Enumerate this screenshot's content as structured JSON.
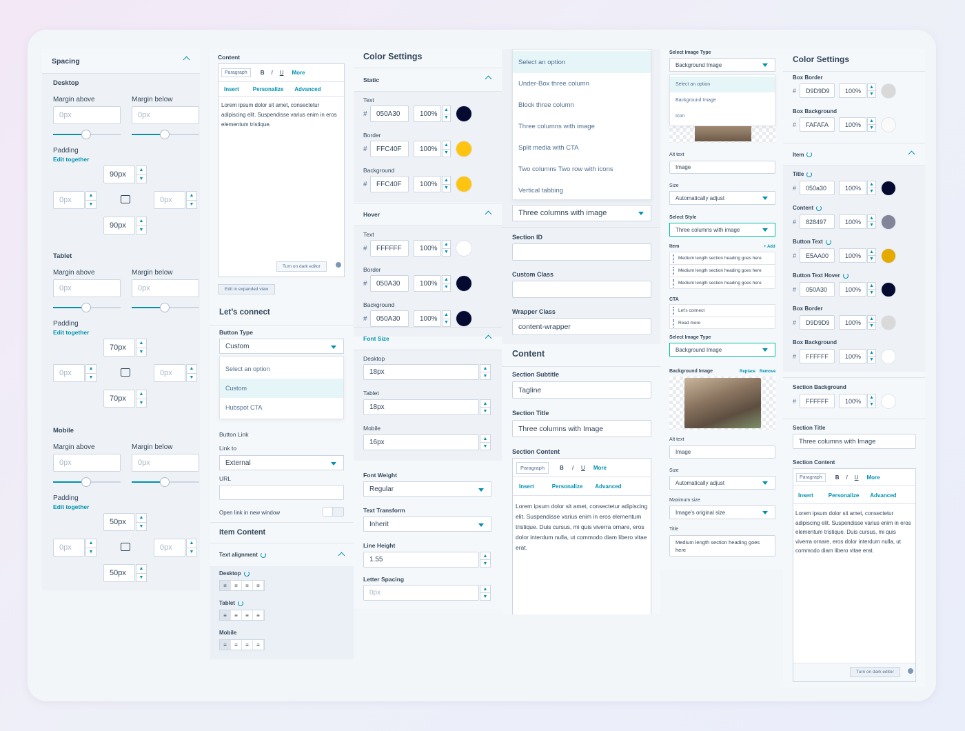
{
  "spacing": {
    "title": "Spacing",
    "desktop": "Desktop",
    "tablet": "Tablet",
    "mobile": "Mobile",
    "margin_above": "Margin above",
    "margin_below": "Margin below",
    "padding": "Padding",
    "edit_together": "Edit together",
    "zero": "0px",
    "desktop_pad": "90px",
    "tablet_pad": "70px",
    "mobile_pad": "50px"
  },
  "content_editor": {
    "label": "Content",
    "paragraph": "Paragraph",
    "more": "More",
    "insert": "Insert",
    "personalize": "Personalize",
    "advanced": "Advanced",
    "text": "Lorem ipsum dolor sit amet, consectetur adipiscing elit. Suspendisse varius enim in eros elementum tristique.",
    "dark_editor": "Turn on dark editor",
    "expanded": "Edit in expanded view"
  },
  "lets_connect": {
    "title": "Let’s connect",
    "button_type": "Button Type",
    "button_type_value": "Custom",
    "options": [
      "Select an option",
      "Custom",
      "Hubspot CTA"
    ],
    "button_link": "Button Link",
    "link_to": "Link to",
    "link_value": "External",
    "url": "URL",
    "open_new": "Open link in new window",
    "item_content": "Item Content",
    "text_alignment": "Text alignment",
    "desktop": "Desktop",
    "tablet": "Tablet",
    "mobile": "Mobile"
  },
  "color_settings": {
    "title": "Color Settings",
    "static": "Static",
    "hover": "Hover",
    "text": "Text",
    "border": "Border",
    "background": "Background",
    "static_text": "050A30",
    "static_border": "FFC40F",
    "static_bg": "FFC40F",
    "hover_text": "FFFFFF",
    "hover_border": "050A30",
    "hover_bg": "050A30",
    "pct": "100%",
    "font_size": "Font Size",
    "desktop": "Desktop",
    "tablet": "Tablet",
    "mobile": "Mobile",
    "fs_desktop": "18px",
    "fs_tablet": "18px",
    "fs_mobile": "16px",
    "font_weight": "Font Weight",
    "font_weight_value": "Regular",
    "text_transform": "Text Transform",
    "text_transform_value": "Inherit",
    "line_height": "Line Height",
    "line_height_value": "1.55",
    "letter_spacing": "Letter Spacing",
    "letter_spacing_value": "0px"
  },
  "layout": {
    "options": [
      "Select an option",
      "Under-Box three column",
      "Block three column",
      "Three columns with image",
      "Split media with CTA",
      "Two columns Two row with icons",
      "Vertical tabbing"
    ],
    "selected": "Three columns with image",
    "section_id": "Section ID",
    "custom_class": "Custom Class",
    "wrapper_class": "Wrapper Class",
    "wrapper_value": "content-wrapper",
    "content": "Content",
    "section_subtitle": "Section Subtitle",
    "subtitle_value": "Tagline",
    "section_title": "Section Title",
    "title_value": "Three columns with Image",
    "section_content": "Section Content",
    "text": "Lorem ipsum dolor sit amet, consectetur adipiscing elit. Suspendisse varius enim in eros elementum tristique. Duis cursus, mi quis viverra ornare, eros dolor interdum nulla, ut commodo diam libero vitae erat."
  },
  "image_col": {
    "select_image_type": "Select Image Type",
    "image_type_value": "Background Image",
    "type_options": [
      "Select an option",
      "Background Image",
      "Icon"
    ],
    "alt_text": "Alt text",
    "alt_value": "Image",
    "size": "Size",
    "size_value": "Automatically adjust",
    "select_style": "Select Style",
    "style_value": "Three columns with image",
    "item": "Item",
    "add": "+ Add",
    "items": [
      "Medium length section heading goes here",
      "Medium length section heading goes here",
      "Medium length section heading goes here"
    ],
    "cta": "CTA",
    "cta_items": [
      "Let’s connect",
      "Read more"
    ],
    "background_image": "Background Image",
    "replace": "Replace",
    "remove": "Remove",
    "max_size": "Maximum size",
    "max_value": "Image's original size",
    "title": "Title",
    "title_value": "Medium length section heading goes here"
  },
  "color2": {
    "title": "Color Settings",
    "box_border": "Box Border",
    "box_border_val": "D9D9D9",
    "box_bg": "Box Background",
    "box_bg_val": "FAFAFA",
    "item": "Item",
    "title_lbl": "Title",
    "title_val": "050a30",
    "content": "Content",
    "content_val": "828497",
    "btn_text": "Button Text",
    "btn_text_val": "E5AA00",
    "btn_hover": "Button Text Hover",
    "btn_hover_val": "050A30",
    "box_border2": "Box Border",
    "box_border2_val": "D9D9D9",
    "box_bg2": "Box Background",
    "box_bg2_val": "FFFFFF",
    "section_bg": "Section Background",
    "section_bg_val": "FFFFFF",
    "section_title": "Section Title",
    "section_title_val": "Three columns with Image",
    "section_content": "Section Content",
    "text": "Lorem ipsum dolor sit amet, consectetur adipiscing elit. Suspendisse varius enim in eros elementum tristique. Duis cursus, mi quis viverra ornare, eros dolor interdum nulla, ut commodo diam libero vitae erat.",
    "pct": "100%"
  },
  "colors": {
    "navy": "#050a30",
    "yellow": "#ffc40f",
    "gold": "#e5aa00",
    "grey": "#828497",
    "light": "#d9d9d9",
    "accent": "#0091ae"
  }
}
